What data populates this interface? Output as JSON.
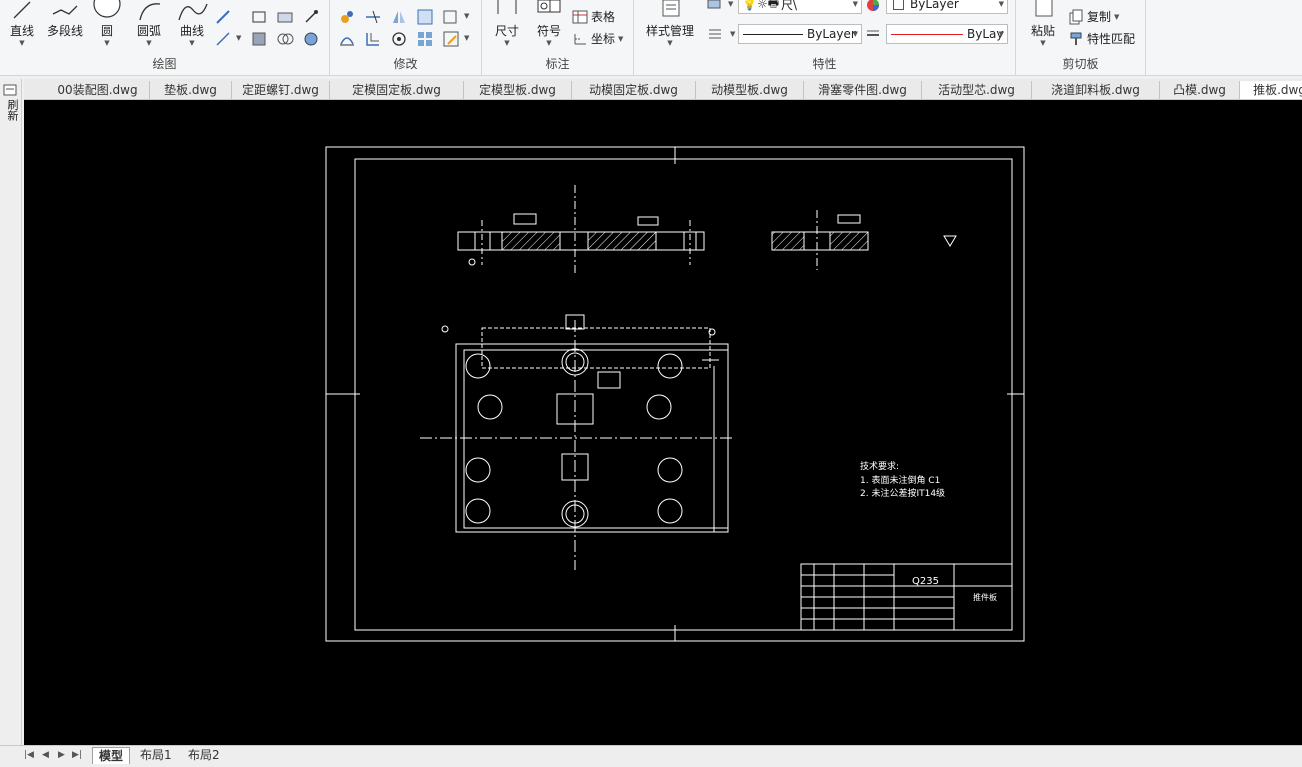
{
  "ribbon": {
    "draw_panel": {
      "label": "绘图",
      "line": "直线",
      "polyline": "多段线",
      "circle": "圆",
      "arc": "圆弧",
      "curve": "曲线"
    },
    "modify_panel": {
      "label": "修改"
    },
    "annotate_panel": {
      "label": "标注",
      "dimension": "尺寸",
      "symbol": "符号",
      "table": "表格",
      "coordinate": "坐标"
    },
    "properties_panel": {
      "label": "特性",
      "style_manager": "样式管理",
      "layer_partial": "尺\\",
      "color_value": "ByLayer",
      "linetype_value": "ByLayer",
      "lineweight_value": "ByLay",
      "color_swatch": "#ffffff",
      "lineweight_color": "#e02020"
    },
    "clipboard_panel": {
      "label": "剪切板",
      "paste": "粘贴",
      "copy": "复制",
      "match_props": "特性匹配"
    }
  },
  "left_strip": {
    "label": "刷新"
  },
  "tabs": [
    "00装配图.dwg",
    "垫板.dwg",
    "定距螺钉.dwg",
    "定模固定板.dwg",
    "定模型板.dwg",
    "动模固定板.dwg",
    "动模型板.dwg",
    "滑塞零件图.dwg",
    "活动型芯.dwg",
    "浇道卸料板.dwg",
    "凸模.dwg",
    "推板.dwg"
  ],
  "drawing": {
    "tech_title": "技术要求:",
    "tech_items": [
      "1. 表面未注倒角 C1",
      "2. 未注公差按IT14级"
    ],
    "material": "Q235",
    "part_name": "推件板"
  },
  "layout_tabs": {
    "model": "模型",
    "layout1": "布局1",
    "layout2": "布局2"
  }
}
